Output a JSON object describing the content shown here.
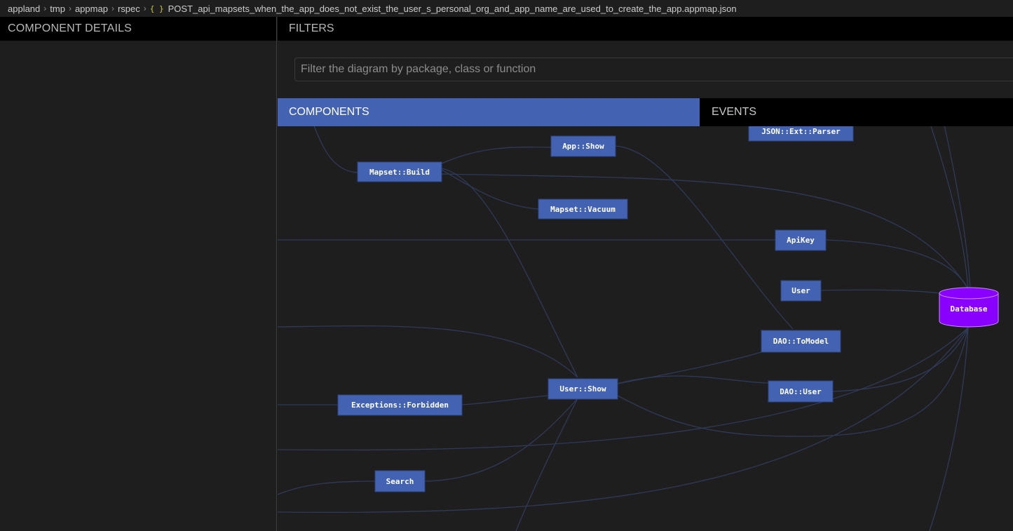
{
  "breadcrumb": {
    "items": [
      "appland",
      "tmp",
      "appmap",
      "rspec"
    ],
    "file_icon": "{ }",
    "file": "POST_api_mapsets_when_the_app_does_not_exist_the_user_s_personal_org_and_app_name_are_used_to_create_the_app.appmap.json"
  },
  "left_panel": {
    "title": "COMPONENT DETAILS"
  },
  "filters": {
    "title": "FILTERS",
    "placeholder": "Filter the diagram by package, class or function",
    "value": ""
  },
  "tabs": {
    "components": "COMPONENTS",
    "events": "EVENTS",
    "active": "components"
  },
  "diagram": {
    "nodes": {
      "json_ext_parser": "JSON::Ext::Parser",
      "app_show": "App::Show",
      "mapset_build": "Mapset::Build",
      "mapset_vacuum": "Mapset::Vacuum",
      "apikey": "ApiKey",
      "user": "User",
      "database": "Database",
      "dao_tomodel": "DAO::ToModel",
      "user_show": "User::Show",
      "exceptions_forbidden": "Exceptions::Forbidden",
      "dao_user": "DAO::User",
      "search": "Search"
    },
    "colors": {
      "node": "#4362b1",
      "database": "#8a00ff",
      "edge": "#2f3a58",
      "active_tab": "#4362b1"
    }
  }
}
